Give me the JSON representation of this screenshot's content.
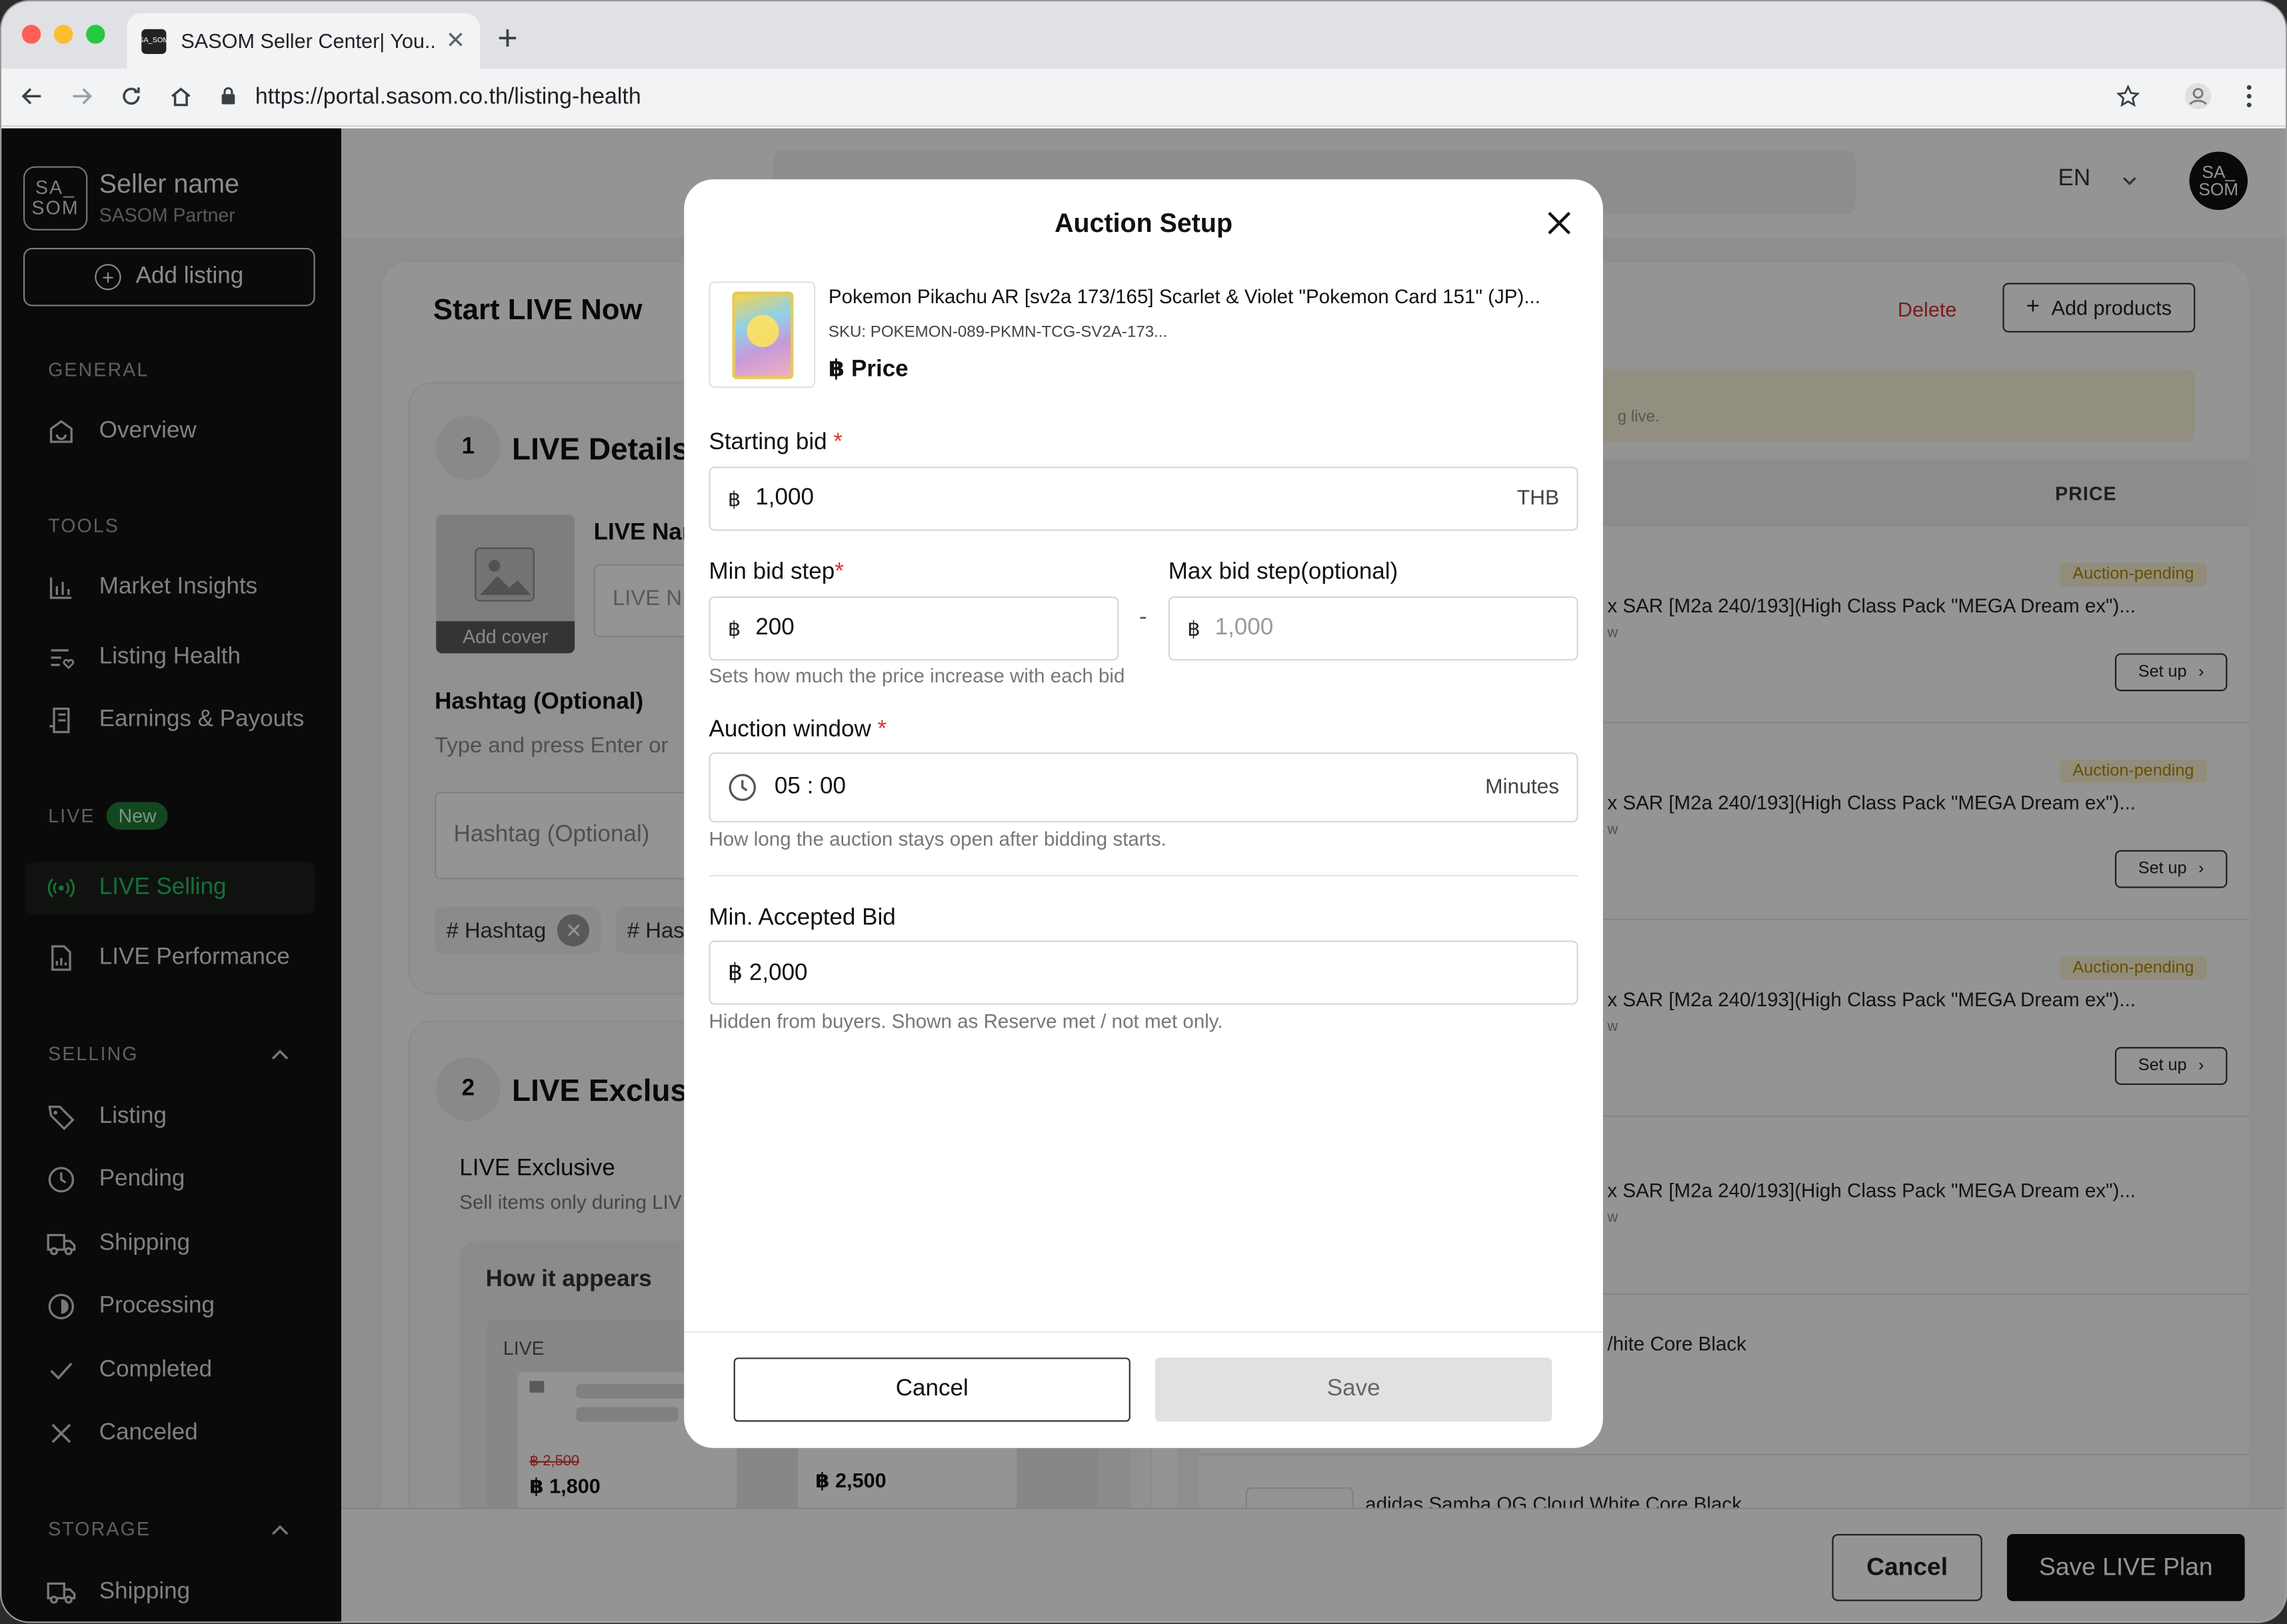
{
  "browser": {
    "tab_title": "SASOM Seller Center| You...",
    "favicon_text": "SA_SOM",
    "url": "https://portal.sasom.co.th/listing-health"
  },
  "sidebar": {
    "logo_text": "SA_ SOM",
    "seller_name": "Seller name",
    "seller_sub": "SASOM Partner",
    "add_listing": "Add listing",
    "section_general": "GENERAL",
    "overview": "Overview",
    "section_tools": "TOOLS",
    "market_insights": "Market Insights",
    "listing_health": "Listing Health",
    "earnings": "Earnings & Payouts",
    "section_live": "LIVE",
    "live_badge": "New",
    "live_selling": "LIVE Selling",
    "live_performance": "LIVE Performance",
    "section_selling": "SELLING",
    "listing": "Listing",
    "pending": "Pending",
    "shipping": "Shipping",
    "processing": "Processing",
    "completed": "Completed",
    "canceled": "Canceled",
    "section_storage": "STORAGE",
    "storage_shipping": "Shipping"
  },
  "topbar": {
    "lang": "EN",
    "avatar_text": "SA_ SOM"
  },
  "left_card": {
    "title": "Start LIVE Now",
    "step1_num": "1",
    "step1_title": "LIVE Details",
    "add_cover": "Add cover",
    "live_name_label": "LIVE Nar",
    "live_name_placeholder": "LIVE N",
    "hashtag_label": "Hashtag (Optional)",
    "hashtag_hint": "Type and press Enter or",
    "hashtag_placeholder": "Hashtag (Optional)",
    "tag1": "# Hashtag",
    "tag2": "# Has",
    "step2_num": "2",
    "step2_title": "LIVE Exclusiv",
    "exclusive_title": "LIVE Exclusive",
    "exclusive_sub": "Sell items only during LIV",
    "how_it_appears": "How it appears",
    "preview_live": "LIVE",
    "preview_old_price": "฿ 2,500",
    "preview_price": "฿ 1,800",
    "preview_price2": "฿ 2,500"
  },
  "right_card": {
    "delete": "Delete",
    "add_products": "Add products",
    "notice_tail": "g live.",
    "price_header": "PRICE",
    "rows": [
      {
        "name": "x SAR [M2a 240/193](High Class Pack \"MEGA Dream ex\")...",
        "sub": "w",
        "status": "Auction-pending",
        "setup": "Set up"
      },
      {
        "name": "x SAR [M2a 240/193](High Class Pack \"MEGA Dream ex\")...",
        "sub": "w",
        "status": "Auction-pending",
        "setup": "Set up"
      },
      {
        "name": "x SAR [M2a 240/193](High Class Pack \"MEGA Dream ex\")...",
        "sub": "w",
        "status": "Auction-pending",
        "setup": "Set up"
      },
      {
        "name": "x SAR [M2a 240/193](High Class Pack \"MEGA Dream ex\")...",
        "sub": "w"
      },
      {
        "name": "/hite Core Black"
      },
      {
        "name": "adidas Samba OG Cloud White Core Black"
      }
    ]
  },
  "bottom_bar": {
    "cancel": "Cancel",
    "save_plan": "Save LIVE Plan"
  },
  "modal": {
    "title": "Auction Setup",
    "product_name": "Pokemon Pikachu AR [sv2a 173/165] Scarlet & Violet \"Pokemon Card 151\" (JP)...",
    "product_sku": "SKU:  POKEMON-089-PKMN-TCG-SV2A-173...",
    "product_price": "฿ Price",
    "currency_symbol": "฿",
    "starting_bid_label": "Starting bid",
    "required_mark": "*",
    "starting_bid_value": "1,000",
    "starting_bid_suffix": "THB",
    "min_step_label": "Min bid step",
    "min_step_value": "200",
    "max_step_label": "Max bid step(optional)",
    "max_step_placeholder": "1,000",
    "step_separator": "-",
    "step_hint": "Sets how much the price increase with each bid",
    "window_label": "Auction window",
    "window_value": "05 : 00",
    "window_suffix": "Minutes",
    "window_hint": "How long the auction stays open after bidding starts.",
    "min_accepted_label": "Min. Accepted Bid",
    "min_accepted_value": "฿ 2,000",
    "min_accepted_hint": "Hidden from buyers. Shown as Reserve met / not met only.",
    "cancel": "Cancel",
    "save": "Save"
  },
  "colors": {
    "accent_green": "#27c25a",
    "danger_red": "#d22f2f",
    "pending_text": "#b38900",
    "sidebar_bg": "#121212"
  }
}
